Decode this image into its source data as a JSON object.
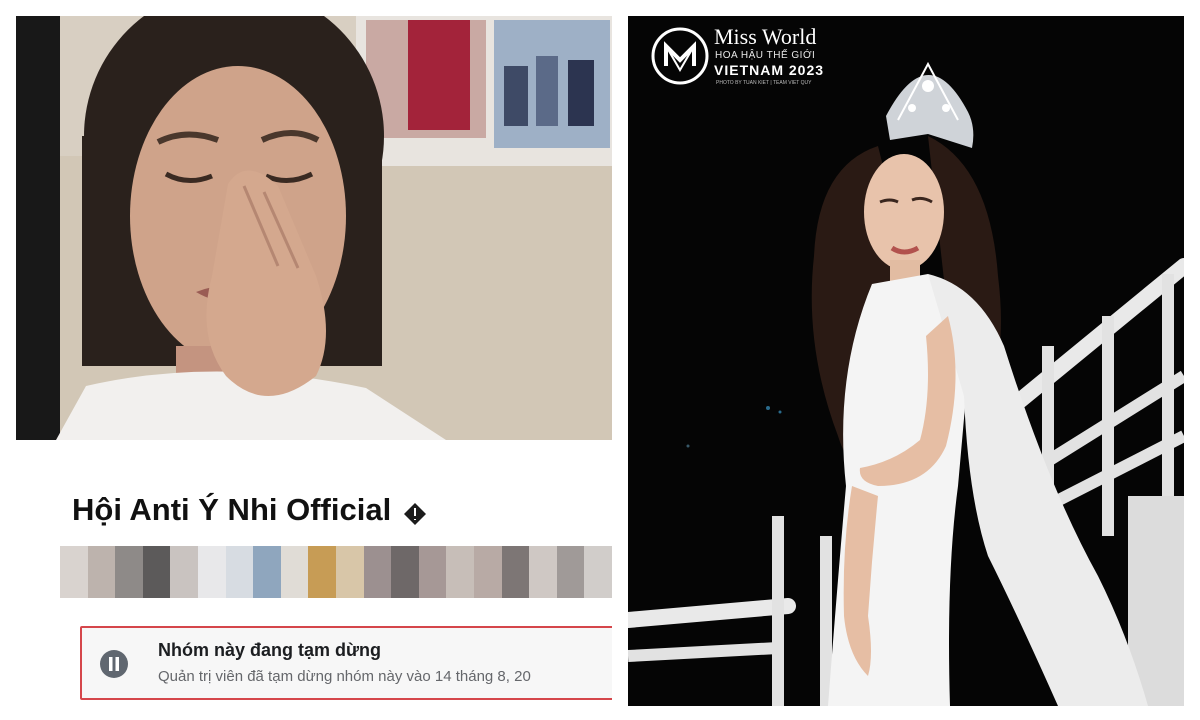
{
  "left": {
    "group_name": "Hội Anti Ý Nhi Official",
    "globe_icon": "globe-privacy-icon",
    "paused": {
      "title": "Nhóm này đang tạm dừng",
      "description": "Quản trị viên đã tạm dừng nhóm này vào 14 tháng 8, 20",
      "icon": "pause-icon",
      "border_color": "#d5464b"
    },
    "pixelated_colors": [
      "#d9d3cf",
      "#bdb3ad",
      "#8e8a88",
      "#5c5a5a",
      "#c9c3c0",
      "#e8e8ea",
      "#d7dce2",
      "#8fa6be",
      "#e0dcd6",
      "#c79c55",
      "#d8c6a8",
      "#9c9090",
      "#6e6868",
      "#a69896",
      "#c7beb8",
      "#b8aaa5",
      "#7d7675",
      "#cfc8c4",
      "#a09a98",
      "#d1cdca"
    ]
  },
  "right": {
    "brand": {
      "logo_icon": "mw-monogram-icon",
      "title": "Miss World",
      "subtitle": "HOA HẬU THẾ GIỚI",
      "year_line": "VIETNAM 2023",
      "credit": "PHOTO BY TUAN KIET | TEAM VIET QUY"
    },
    "background_color": "#050505"
  }
}
